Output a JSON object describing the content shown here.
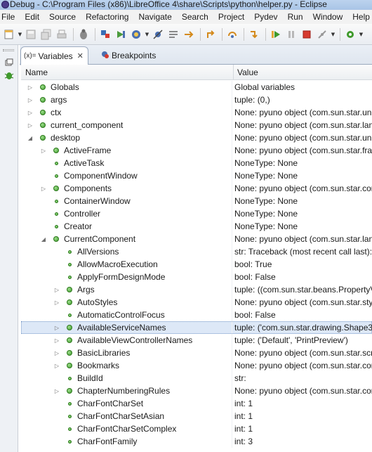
{
  "window": {
    "title": "Debug - C:\\Program Files (x86)\\LibreOffice 4\\share\\Scripts\\python\\helper.py - Eclipse"
  },
  "menu": [
    "File",
    "Edit",
    "Source",
    "Refactoring",
    "Navigate",
    "Search",
    "Project",
    "Pydev",
    "Run",
    "Window",
    "Help"
  ],
  "tabs": [
    {
      "label": "Variables",
      "icon": "variables-icon",
      "prefix": "(x)=",
      "active": true
    },
    {
      "label": "Breakpoints",
      "icon": "breakpoints-icon",
      "active": false
    }
  ],
  "columns": {
    "name": "Name",
    "value": "Value"
  },
  "rows": [
    {
      "level": 0,
      "expander": "collapsed",
      "dot": "large",
      "name": "Globals",
      "value": "Global variables"
    },
    {
      "level": 0,
      "expander": "collapsed",
      "dot": "large",
      "name": "args",
      "value": "tuple: (0,)"
    },
    {
      "level": 0,
      "expander": "collapsed",
      "dot": "large",
      "name": "ctx",
      "value": "None: pyuno object (com.sun.star.uno"
    },
    {
      "level": 0,
      "expander": "collapsed",
      "dot": "large",
      "name": "current_component",
      "value": "None: pyuno object (com.sun.star.lang"
    },
    {
      "level": 0,
      "expander": "expanded",
      "dot": "large",
      "name": "desktop",
      "value": "None: pyuno object (com.sun.star.uno"
    },
    {
      "level": 1,
      "expander": "collapsed",
      "dot": "large",
      "name": "ActiveFrame",
      "value": "None: pyuno object (com.sun.star.fram"
    },
    {
      "level": 1,
      "expander": "none",
      "dot": "small",
      "name": "ActiveTask",
      "value": "NoneType: None"
    },
    {
      "level": 1,
      "expander": "none",
      "dot": "small",
      "name": "ComponentWindow",
      "value": "NoneType: None"
    },
    {
      "level": 1,
      "expander": "collapsed",
      "dot": "large",
      "name": "Components",
      "value": "None: pyuno object (com.sun.star.con"
    },
    {
      "level": 1,
      "expander": "none",
      "dot": "small",
      "name": "ContainerWindow",
      "value": "NoneType: None"
    },
    {
      "level": 1,
      "expander": "none",
      "dot": "small",
      "name": "Controller",
      "value": "NoneType: None"
    },
    {
      "level": 1,
      "expander": "none",
      "dot": "small",
      "name": "Creator",
      "value": "NoneType: None"
    },
    {
      "level": 1,
      "expander": "expanded",
      "dot": "large",
      "name": "CurrentComponent",
      "value": "None: pyuno object (com.sun.star.lang"
    },
    {
      "level": 2,
      "expander": "none",
      "dot": "small",
      "name": "AllVersions",
      "value": "str: Traceback (most recent call last):\\"
    },
    {
      "level": 2,
      "expander": "none",
      "dot": "small",
      "name": "AllowMacroExecution",
      "value": "bool: True"
    },
    {
      "level": 2,
      "expander": "none",
      "dot": "small",
      "name": "ApplyFormDesignMode",
      "value": "bool: False"
    },
    {
      "level": 2,
      "expander": "collapsed",
      "dot": "large",
      "name": "Args",
      "value": "tuple: ((com.sun.star.beans.PropertyVa"
    },
    {
      "level": 2,
      "expander": "collapsed",
      "dot": "large",
      "name": "AutoStyles",
      "value": "None: pyuno object (com.sun.star.styl"
    },
    {
      "level": 2,
      "expander": "none",
      "dot": "small",
      "name": "AutomaticControlFocus",
      "value": "bool: False"
    },
    {
      "level": 2,
      "expander": "collapsed",
      "dot": "large",
      "name": "AvailableServiceNames",
      "value": "tuple: ('com.sun.star.drawing.Shape3D",
      "selected": true
    },
    {
      "level": 2,
      "expander": "collapsed",
      "dot": "large",
      "name": "AvailableViewControllerNames",
      "value": "tuple: ('Default', 'PrintPreview')"
    },
    {
      "level": 2,
      "expander": "collapsed",
      "dot": "large",
      "name": "BasicLibraries",
      "value": "None: pyuno object (com.sun.star.scr"
    },
    {
      "level": 2,
      "expander": "collapsed",
      "dot": "large",
      "name": "Bookmarks",
      "value": "None: pyuno object (com.sun.star.con"
    },
    {
      "level": 2,
      "expander": "none",
      "dot": "small",
      "name": "BuildId",
      "value": "str:"
    },
    {
      "level": 2,
      "expander": "collapsed",
      "dot": "large",
      "name": "ChapterNumberingRules",
      "value": "None: pyuno object (com.sun.star.con"
    },
    {
      "level": 2,
      "expander": "none",
      "dot": "small",
      "name": "CharFontCharSet",
      "value": "int: 1"
    },
    {
      "level": 2,
      "expander": "none",
      "dot": "small",
      "name": "CharFontCharSetAsian",
      "value": "int: 1"
    },
    {
      "level": 2,
      "expander": "none",
      "dot": "small",
      "name": "CharFontCharSetComplex",
      "value": "int: 1"
    },
    {
      "level": 2,
      "expander": "none",
      "dot": "small",
      "name": "CharFontFamily",
      "value": "int: 3"
    }
  ]
}
